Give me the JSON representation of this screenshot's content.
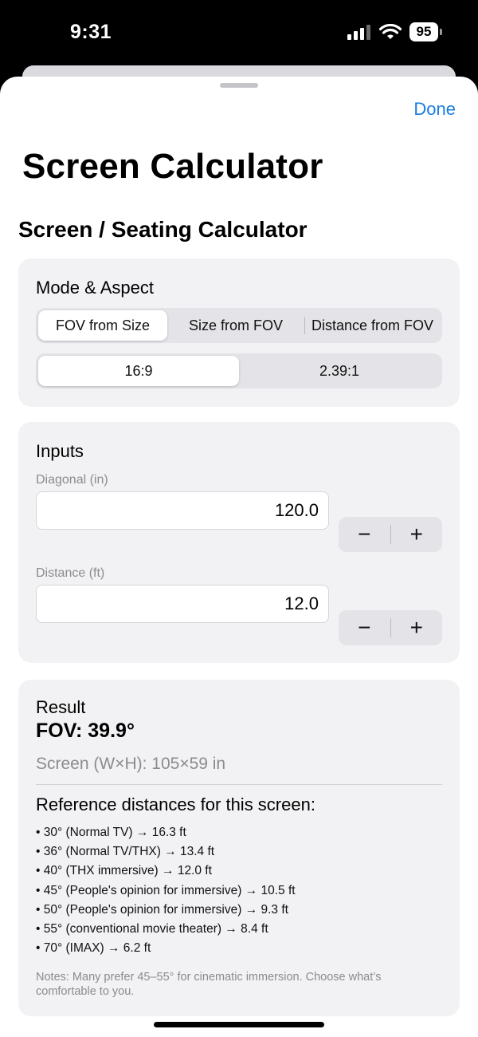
{
  "status": {
    "time": "9:31",
    "battery": "95"
  },
  "nav": {
    "done_label": "Done"
  },
  "page": {
    "large_title": "Screen Calculator",
    "section_title": "Screen / Seating Calculator"
  },
  "mode_card": {
    "title": "Mode & Aspect",
    "modes": [
      "FOV from Size",
      "Size from FOV",
      "Distance from FOV"
    ],
    "selected_mode": "FOV from Size",
    "aspects": [
      "16:9",
      "2.39:1"
    ],
    "selected_aspect": "16:9"
  },
  "inputs_card": {
    "title": "Inputs",
    "diagonal_label": "Diagonal (in)",
    "diagonal_value": "120.0",
    "distance_label": "Distance (ft)",
    "distance_value": "12.0",
    "minus": "−",
    "plus": "+"
  },
  "result_card": {
    "title": "Result",
    "fov": "FOV: 39.9°",
    "screen_dims": "Screen (W×H): 105×59 in",
    "ref_title": "Reference distances for this screen:",
    "references": [
      "30° (Normal TV) → 16.3 ft",
      "36° (Normal TV/THX) → 13.4 ft",
      "40° (THX immersive) → 12.0 ft",
      "45° (People's opinion for immersive) → 10.5 ft",
      "50° (People's opinion for immersive) → 9.3 ft",
      "55° (conventional movie theater) → 8.4 ft",
      "70° (IMAX) → 6.2 ft"
    ],
    "notes": "Notes: Many prefer 45–55° for cinematic immersion. Choose what’s comfortable to you."
  },
  "colors": {
    "accent": "#1a7ee0",
    "card_bg": "#f2f2f4",
    "secondary_text": "#8b8b90"
  }
}
